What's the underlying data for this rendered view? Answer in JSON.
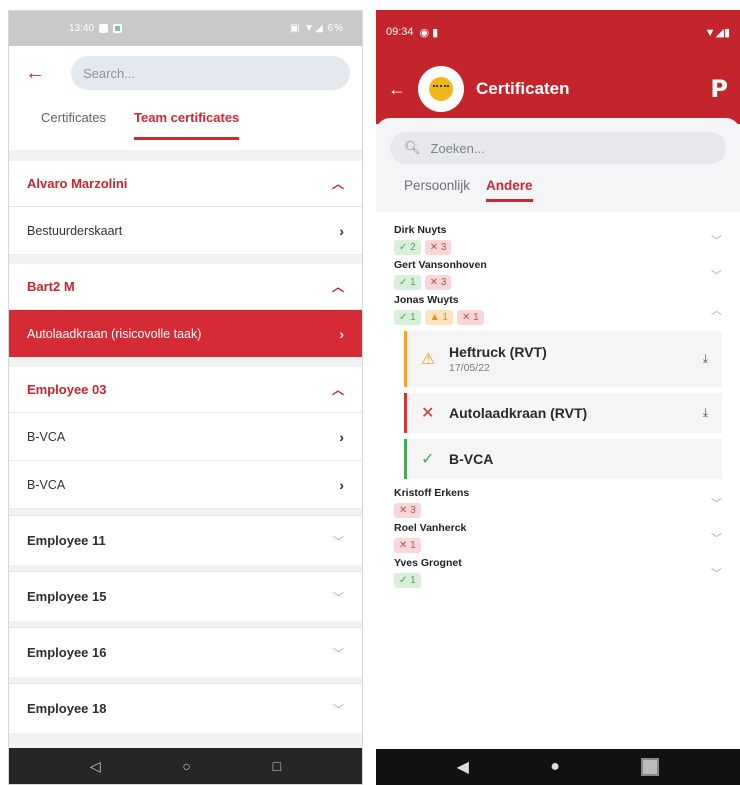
{
  "left": {
    "status": {
      "time": "13:40",
      "right": "6%"
    },
    "search_placeholder": "Search...",
    "tabs": [
      {
        "label": "Certificates",
        "active": false
      },
      {
        "label": "Team certificates",
        "active": true
      }
    ],
    "groups": [
      {
        "name": "Alvaro Marzolini",
        "items": [
          {
            "label": "Bestuurderskaart",
            "highlighted": false
          }
        ]
      },
      {
        "name": "Bart2 M",
        "items": [
          {
            "label": "Autolaadkraan (risicovolle taak)",
            "highlighted": true
          }
        ]
      },
      {
        "name": "Employee 03",
        "items": [
          {
            "label": "B-VCA",
            "highlighted": false
          },
          {
            "label": "B-VCA",
            "highlighted": false
          }
        ]
      }
    ],
    "collapsed": [
      "Employee 11",
      "Employee 15",
      "Employee 16",
      "Employee 18"
    ],
    "nav": {
      "back": "◁",
      "home": "○",
      "recent": "□"
    }
  },
  "right": {
    "status": {
      "time": "09:34"
    },
    "title": "Certificaten",
    "search_placeholder": "Zoeken...",
    "tabs": [
      {
        "label": "Persoonlijk",
        "active": false
      },
      {
        "label": "Andere",
        "active": true
      }
    ],
    "people": [
      {
        "name": "Dirk Nuyts",
        "ok": "✓ 2",
        "x": "✕ 3"
      },
      {
        "name": "Gert Vansonhoven",
        "ok": "✓ 1",
        "x": "✕ 3"
      },
      {
        "name": "Jonas Wuyts",
        "ok": "✓ 1",
        "warn": "▲ 1",
        "x": "✕ 1"
      },
      {
        "name": "Kristoff Erkens",
        "x": "✕ 3"
      },
      {
        "name": "Roel Vanherck",
        "x": "✕ 1"
      },
      {
        "name": "Yves Grognet",
        "ok": "✓ 1"
      }
    ],
    "certs": [
      {
        "name": "Heftruck (RVT)",
        "date": "17/05/22",
        "status": "warning"
      },
      {
        "name": "Autolaadkraan (RVT)",
        "status": "invalid"
      },
      {
        "name": "B-VCA",
        "status": "valid"
      }
    ]
  },
  "colors": {
    "brand_red": "#c4242c",
    "highlight_red": "#d52b35",
    "ok_green": "#4aa85a",
    "warn_orange": "#ec9a22"
  }
}
